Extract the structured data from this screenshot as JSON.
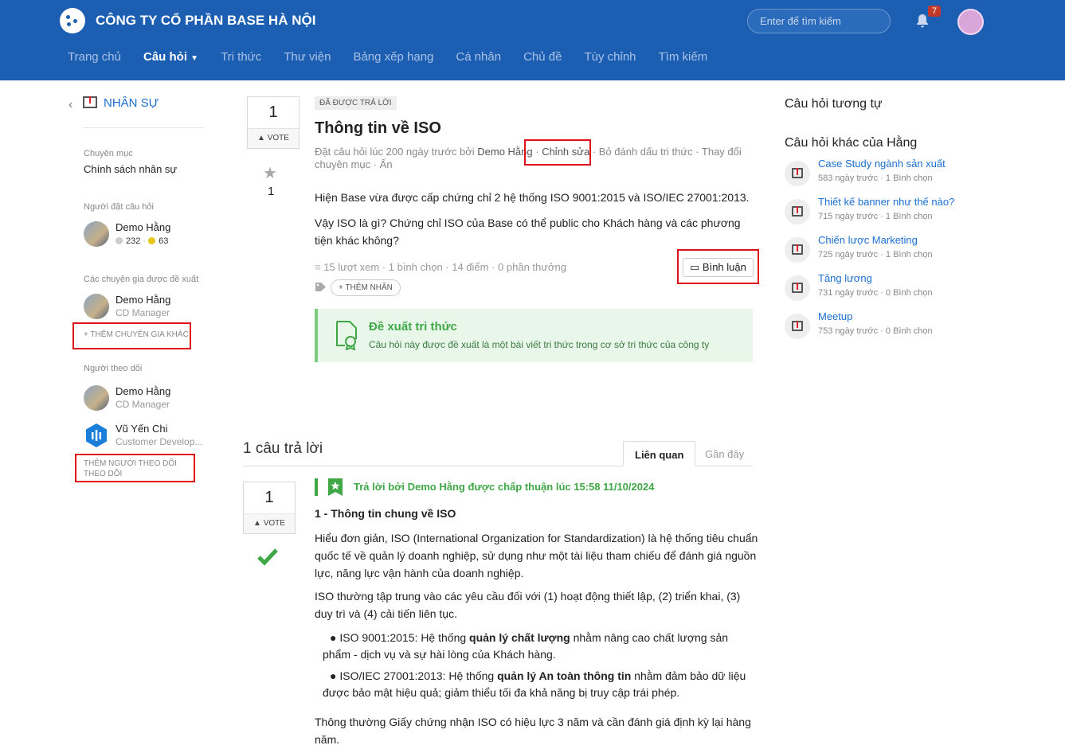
{
  "header": {
    "company": "CÔNG TY CỔ PHẦN BASE HÀ NỘI",
    "search_placeholder": "Enter để tìm kiếm",
    "notification_count": "7",
    "nav": [
      "Trang chủ",
      "Câu hỏi",
      "Tri thức",
      "Thư viện",
      "Bảng xếp hạng",
      "Cá nhân",
      "Chủ đề",
      "Tùy chỉnh",
      "Tìm kiếm"
    ],
    "active_nav": "Câu hỏi"
  },
  "sidebar": {
    "category_title": "NHÂN SỰ",
    "category_label": "Chuyên mục",
    "category_value": "Chính sách nhân sự",
    "asker_label": "Người đặt câu hỏi",
    "asker": {
      "name": "Demo Hằng",
      "points_gray": "232",
      "points_gold": "63"
    },
    "experts_label": "Các chuyên gia được đề xuất",
    "expert": {
      "name": "Demo Hằng",
      "role": "CD Manager"
    },
    "add_expert": "+ THÊM CHUYÊN GIA KHÁC",
    "followers_label": "Người theo dõi",
    "followers": [
      {
        "name": "Demo Hằng",
        "role": "CD Manager"
      },
      {
        "name": "Vũ Yến Chi",
        "role": "Customer Develop..."
      }
    ],
    "add_follower_line1": "THÊM NGƯỜI THEO DÕI",
    "add_follower_line2": "THEO DÕI"
  },
  "question": {
    "votes": "1",
    "vote_label": "VOTE",
    "favorites": "1",
    "status_tag": "ĐÃ ĐƯỢC TRẢ LỜI",
    "title": "Thông tin về ISO",
    "meta_prefix": "Đặt câu hỏi lúc 200 ngày trước bởi ",
    "meta_author": "Demo Hằng",
    "meta_sep1": " · ",
    "meta_edit": "Chỉnh sửa",
    "meta_rest": " · Bỏ đánh dấu tri thức · Thay đổi chuyên mục · Ẩn",
    "body_1": "Hiện Base vừa được cấp chứng chỉ 2 hệ thống ISO 9001:2015 và ISO/IEC 27001:2013.",
    "body_2": "Vậy ISO là gì? Chứng chỉ ISO của Base có thể public cho Khách hàng và các phương tiện khác không?",
    "stats": "15 lượt xem · 1 bình chọn · 14 điểm · 0 phần thưởng",
    "comment_button": "Bình luận",
    "add_tag": "+ THÊM NHÃN",
    "suggest_title": "Đề xuất tri thức",
    "suggest_desc": "Câu hỏi này được đề xuất là một bài viết tri thức trong cơ sở tri thức của công ty"
  },
  "answers": {
    "count_text": "1 câu trả lời",
    "tab_related": "Liên quan",
    "tab_recent": "Gần đây",
    "votes": "1",
    "vote_label": "VOTE",
    "accepted_text": "Trả lời bởi Demo Hằng được chấp thuận lúc 15:58 11/10/2024",
    "heading": "1 - Thông tin chung về ISO",
    "p1": "Hiểu đơn giản, ISO (International Organization for Standardization) là hệ thống tiêu chuẩn quốc tế về quản lý doanh nghiệp, sử dụng như một tài liệu tham chiếu để đánh giá nguồn lực, năng lực vận hành của doanh nghiệp.",
    "p2": "ISO thường tập trung vào các yêu cầu đối với (1) hoạt động thiết lập, (2) triển khai, (3) duy trì và (4) cải tiến liên tục.",
    "b1_pre": "ISO 9001:2015: Hệ thống ",
    "b1_bold": "quản lý chất lượng",
    "b1_post": " nhằm nâng cao chất lượng sản phẩm - dịch vụ và sự hài lòng của Khách hàng.",
    "b2_pre": "ISO/IEC 27001:2013: Hệ thống ",
    "b2_bold": "quản lý An toàn thông tin",
    "b2_post": " nhằm đảm bảo dữ liệu được bảo mật hiệu quả; giảm thiểu tối đa khả năng bị truy cập trái phép.",
    "p3": "Thông thường Giấy chứng nhận ISO có hiệu lực 3 năm và cần đánh giá định kỳ lại hàng năm."
  },
  "right": {
    "similar_title": "Câu hỏi tương tự",
    "other_title": "Câu hỏi khác của Hằng",
    "items": [
      {
        "title": "Case Study ngành sản xuất",
        "meta": "583 ngày trước · 1 Bình chọn"
      },
      {
        "title": "Thiết kế banner như thế nào?",
        "meta": "715 ngày trước · 1 Bình chọn"
      },
      {
        "title": "Chiến lược Marketing",
        "meta": "725 ngày trước · 1 Bình chọn"
      },
      {
        "title": "Tăng lương",
        "meta": "731 ngày trước · 0 Bình chọn"
      },
      {
        "title": "Meetup",
        "meta": "753 ngày trước · 0 Bình chọn"
      }
    ]
  },
  "colors": {
    "header": "#1c5fb2",
    "link": "#1c6fd0",
    "success": "#3fa746",
    "highlight": "#e0101a"
  }
}
